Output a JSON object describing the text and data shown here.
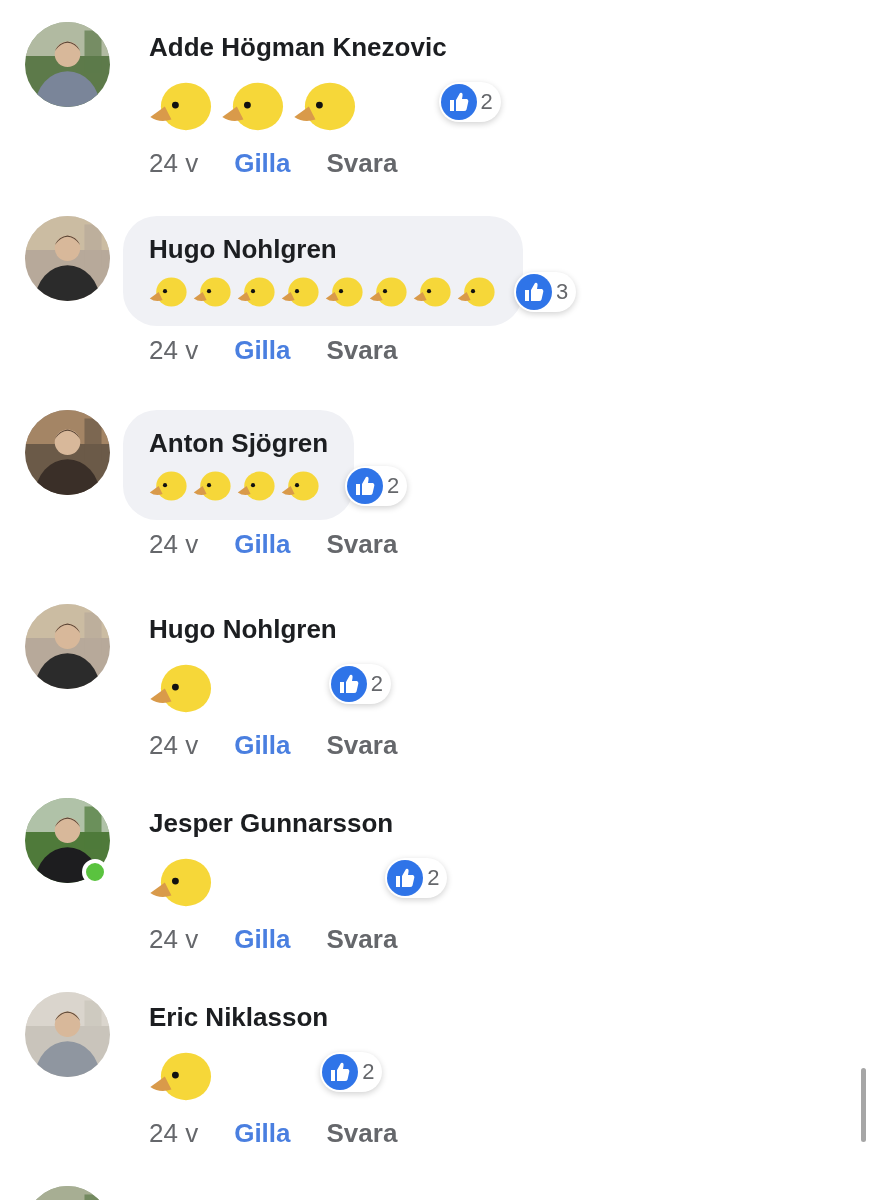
{
  "comments": [
    {
      "avatar": {
        "kind": "picture"
      },
      "online": false,
      "author": "Adde Högman Knezovic",
      "bubble": false,
      "emojis": [
        {
          "kind": "chick"
        },
        {
          "kind": "chick"
        },
        {
          "kind": "chick"
        }
      ],
      "likes": "2",
      "time": "24 v",
      "like_label": "Gilla",
      "liked": true,
      "reply_label": "Svara"
    },
    {
      "avatar": {
        "kind": "picture"
      },
      "online": false,
      "author": "Hugo Nohlgren",
      "bubble": true,
      "emojis": [
        {
          "kind": "chick"
        },
        {
          "kind": "chick"
        },
        {
          "kind": "chick"
        },
        {
          "kind": "chick"
        },
        {
          "kind": "chick"
        },
        {
          "kind": "chick"
        },
        {
          "kind": "chick"
        },
        {
          "kind": "chick"
        }
      ],
      "likes": "3",
      "time": "24 v",
      "like_label": "Gilla",
      "liked": true,
      "reply_label": "Svara"
    },
    {
      "avatar": {
        "kind": "picture"
      },
      "online": false,
      "author": "Anton Sjögren",
      "bubble": true,
      "emojis": [
        {
          "kind": "chick"
        },
        {
          "kind": "chick"
        },
        {
          "kind": "chick"
        },
        {
          "kind": "chick"
        }
      ],
      "likes": "2",
      "time": "24 v",
      "like_label": "Gilla",
      "liked": true,
      "reply_label": "Svara"
    },
    {
      "avatar": {
        "kind": "picture"
      },
      "online": false,
      "author": "Hugo Nohlgren",
      "bubble": false,
      "emojis": [
        {
          "kind": "chick"
        }
      ],
      "likes": "2",
      "time": "24 v",
      "like_label": "Gilla",
      "liked": true,
      "reply_label": "Svara"
    },
    {
      "avatar": {
        "kind": "picture"
      },
      "online": true,
      "author": "Jesper Gunnarsson",
      "bubble": false,
      "emojis": [
        {
          "kind": "chick"
        }
      ],
      "likes": "2",
      "time": "24 v",
      "like_label": "Gilla",
      "liked": true,
      "reply_label": "Svara"
    },
    {
      "avatar": {
        "kind": "picture"
      },
      "online": false,
      "author": "Eric Niklasson",
      "bubble": false,
      "emojis": [
        {
          "kind": "chick"
        }
      ],
      "likes": "2",
      "time": "24 v",
      "like_label": "Gilla",
      "liked": true,
      "reply_label": "Svara"
    }
  ],
  "next_comment": {
    "avatar": {
      "kind": "picture"
    }
  }
}
